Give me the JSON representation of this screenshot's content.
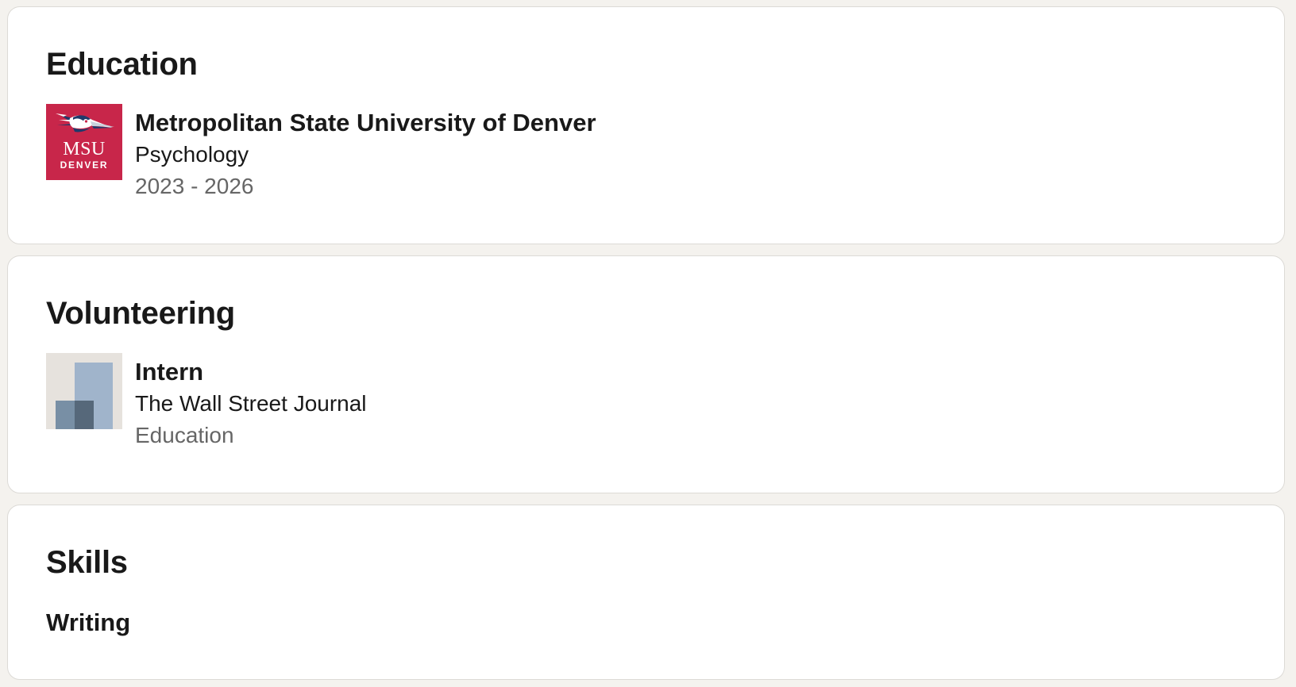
{
  "education": {
    "title": "Education",
    "school": "Metropolitan State University of Denver",
    "field": "Psychology",
    "dates": "2023 - 2026",
    "logo": {
      "main_text": "MSU",
      "small_text": "DENVER",
      "background_color": "#c8264a",
      "icon": "roadrunner-mascot-icon"
    }
  },
  "volunteering": {
    "title": "Volunteering",
    "role": "Intern",
    "organization": "The Wall Street Journal",
    "cause": "Education",
    "logo": {
      "icon": "company-placeholder-icon",
      "colors": [
        "#e6e2dd",
        "#a0b4cb",
        "#788fa5",
        "#56687a"
      ]
    }
  },
  "skills": {
    "title": "Skills",
    "items": [
      "Writing"
    ]
  }
}
